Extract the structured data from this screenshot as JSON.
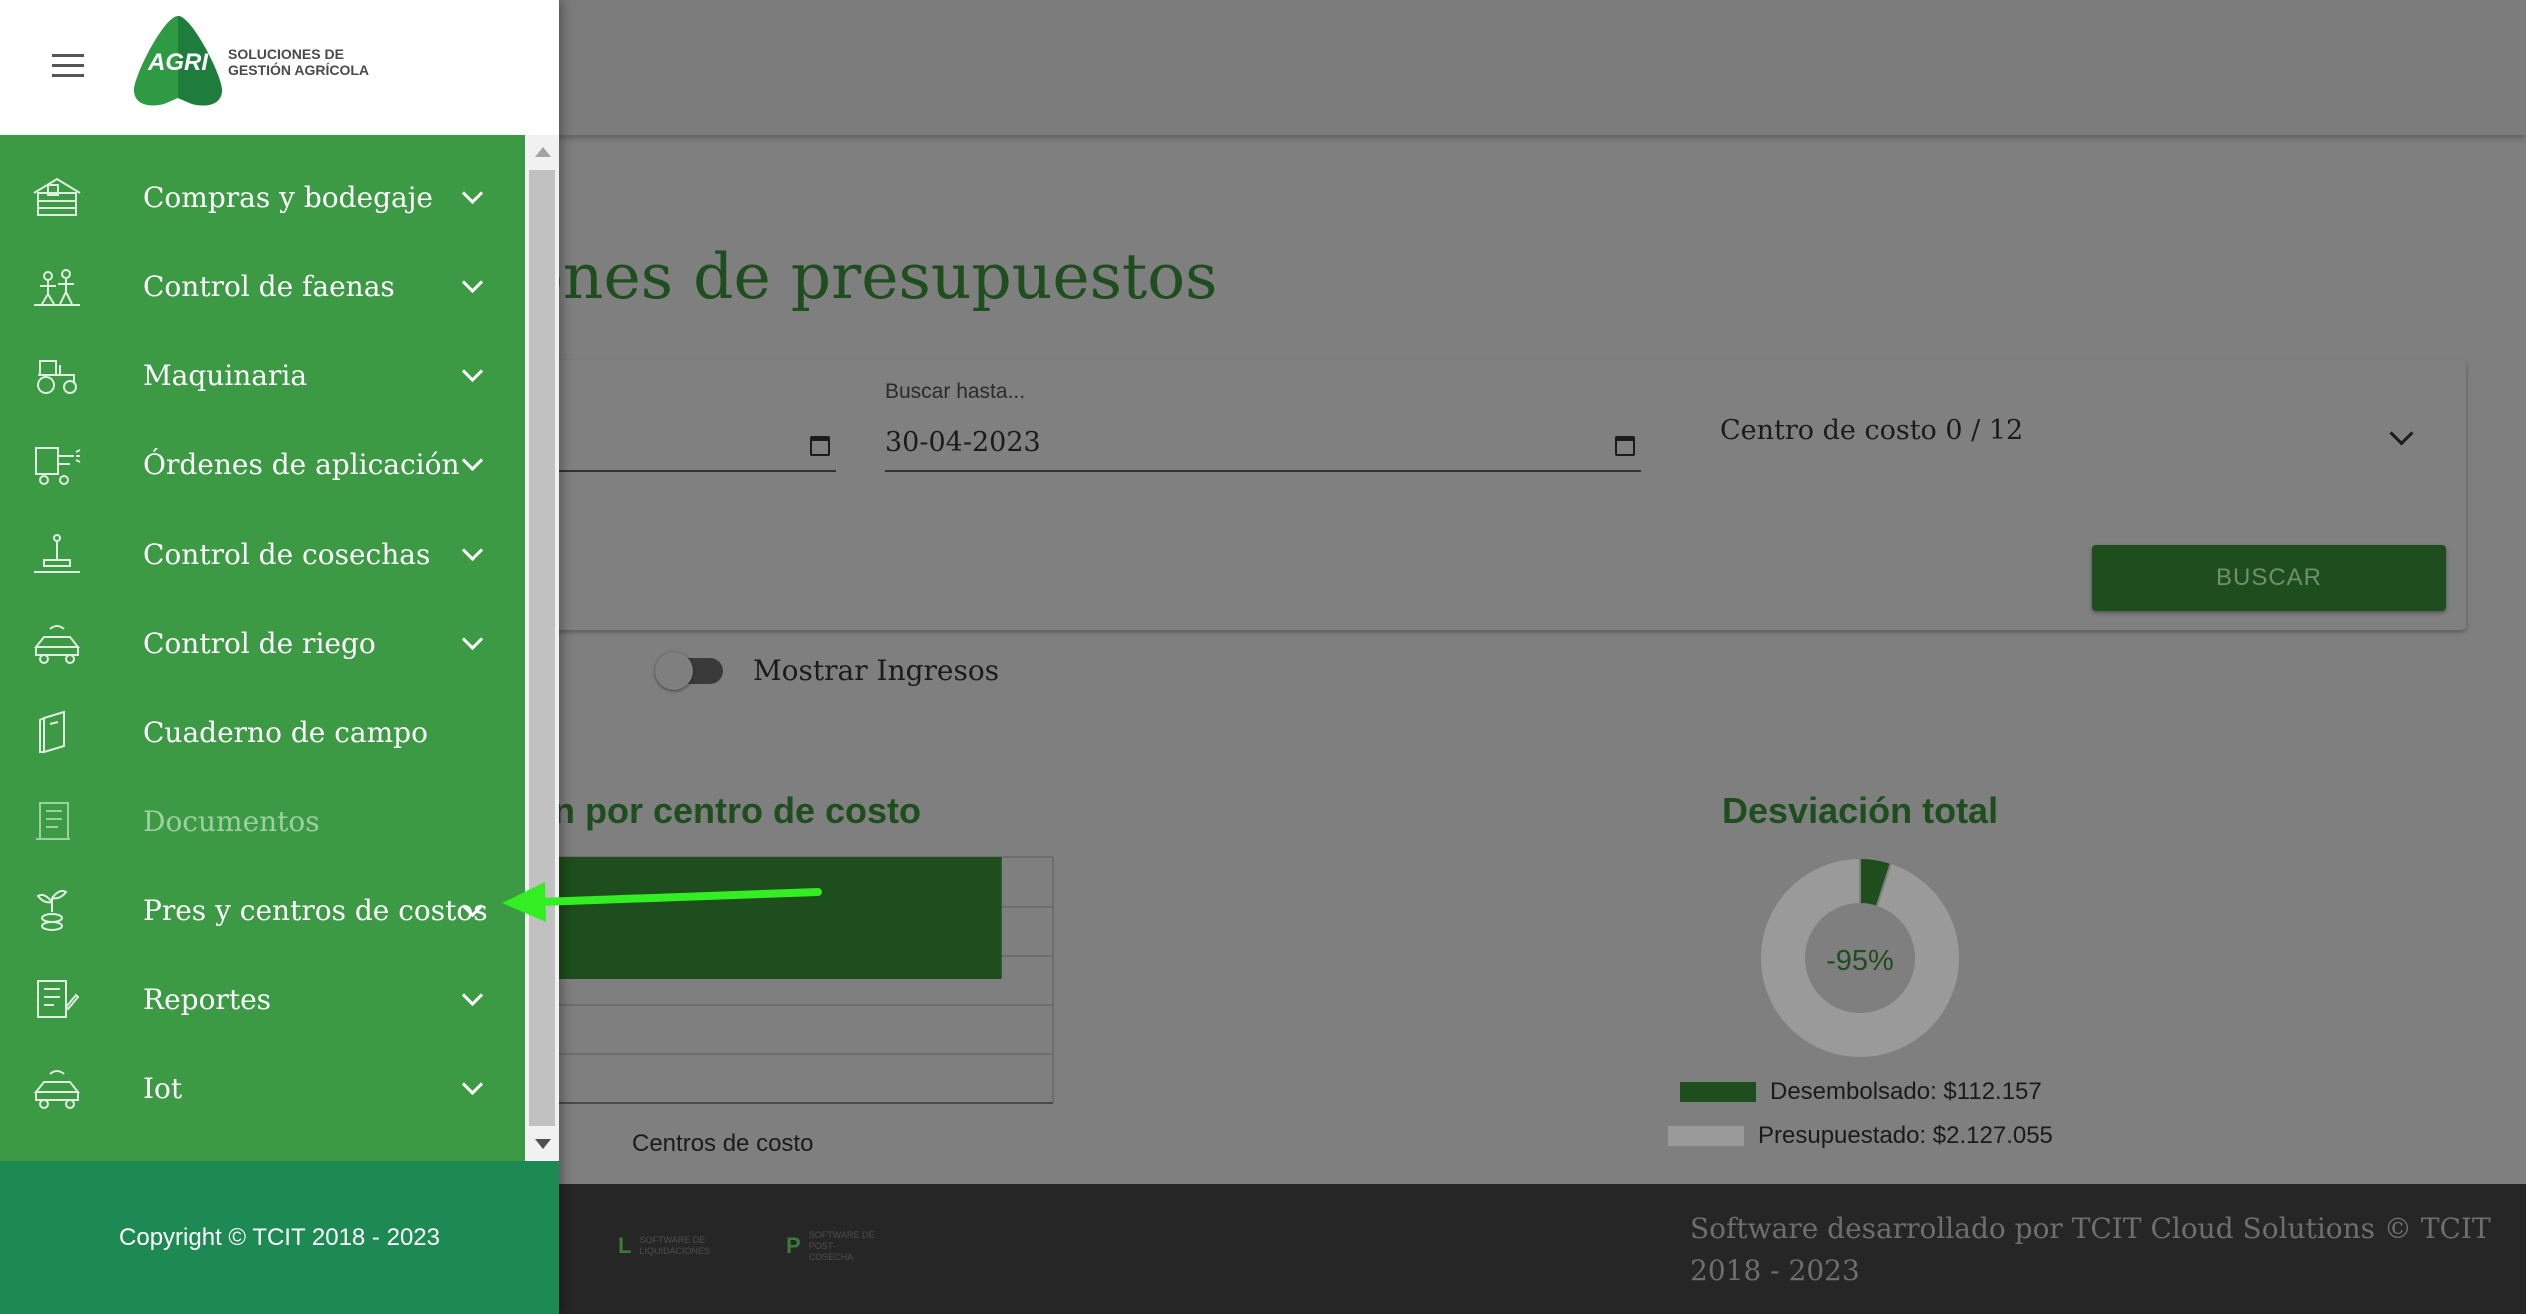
{
  "page": {
    "title": "ones de presupuestos"
  },
  "filters": {
    "hasta_label": "Buscar hasta...",
    "hasta_value": "30-04-2023",
    "centro_costo": "Centro de costo 0 / 12",
    "buscar_button": "BUSCAR",
    "toggle_label": "Mostrar Ingresos",
    "toggle_on": false
  },
  "charts": {
    "bar_title": "n por centro de costo",
    "bar_xlabel": "Centros de costo",
    "donut_title": "Desviación total",
    "donut_center": "-95%",
    "legend_desembolsado": "Desembolsado: $112.157",
    "legend_presupuestado": "Presupuestado: $2.127.055"
  },
  "chart_data": [
    {
      "type": "bar",
      "orientation": "horizontal",
      "title": "n por centro de costo",
      "xlabel": "Centros de costo",
      "categories": [
        ""
      ],
      "values": [
        0.9
      ],
      "colors": [
        "#1e4d1e"
      ]
    },
    {
      "type": "pie",
      "title": "Desviación total",
      "center_label": "-95%",
      "labels": [
        "Desembolsado: $112.157",
        "Presupuestado: $2.127.055"
      ],
      "values": [
        112157,
        2127055
      ],
      "colors": [
        "#1e4d1e",
        "#9a9a9a"
      ]
    }
  ],
  "footer": {
    "text": "Software desarrollado por TCIT Cloud Solutions © TCIT 2018 - 2023",
    "logos": [
      {
        "mark": "L",
        "text": "SOFTWARE DE LIQUIDACIONES"
      },
      {
        "mark": "P",
        "text": "SOFTWARE DE POST-COSECHA"
      }
    ]
  },
  "drawer": {
    "logo_mark": "AGRI",
    "logo_text_1": "SOLUCIONES DE",
    "logo_text_2": "GESTIÓN AGRÍCOLA",
    "copyright": "Copyright © TCIT 2018 - 2023",
    "items": [
      {
        "label": "Compras y bodegaje",
        "icon": "warehouse-icon",
        "expandable": true,
        "disabled": false
      },
      {
        "label": "Control de faenas",
        "icon": "workers-icon",
        "expandable": true,
        "disabled": false
      },
      {
        "label": "Maquinaria",
        "icon": "tractor-icon",
        "expandable": true,
        "disabled": false
      },
      {
        "label": "Órdenes de aplicación",
        "icon": "sprayer-icon",
        "expandable": true,
        "disabled": false
      },
      {
        "label": "Control de cosechas",
        "icon": "scale-icon",
        "expandable": true,
        "disabled": false
      },
      {
        "label": "Control de riego",
        "icon": "irrigation-icon",
        "expandable": true,
        "disabled": false
      },
      {
        "label": "Cuaderno de campo",
        "icon": "notebook-icon",
        "expandable": false,
        "disabled": false
      },
      {
        "label": "Documentos",
        "icon": "document-icon",
        "expandable": false,
        "disabled": true
      },
      {
        "label": "Pres y centros de costos",
        "icon": "plant-coins-icon",
        "expandable": true,
        "disabled": false
      },
      {
        "label": "Reportes",
        "icon": "report-icon",
        "expandable": true,
        "disabled": false
      },
      {
        "label": "Iot",
        "icon": "iot-icon",
        "expandable": true,
        "disabled": false
      }
    ]
  },
  "colors": {
    "drawer_green": "#3c9a45",
    "footer_green": "#1d8a53",
    "dark_green": "#1e4d1e",
    "annotation_arrow": "#33ee22"
  }
}
